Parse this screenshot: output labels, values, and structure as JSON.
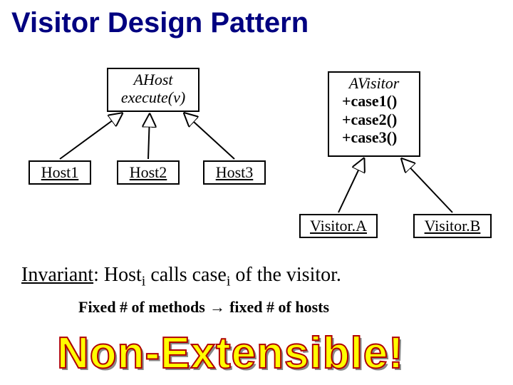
{
  "title": "Visitor Design Pattern",
  "abstract_host": {
    "name": "AHost",
    "method": "execute(v)"
  },
  "hosts": [
    "Host1",
    "Host2",
    "Host3"
  ],
  "abstract_visitor": {
    "name": "AVisitor",
    "methods": [
      "+case1()",
      "+case2()",
      "+case3()"
    ]
  },
  "visitors": [
    "Visitor.A",
    "Visitor.B"
  ],
  "invariant": {
    "label": "Invariant",
    "text_1": ": Host",
    "sub_1": "i",
    "text_2": " calls case",
    "sub_2": "i",
    "text_3": " of the visitor."
  },
  "fixed_line": {
    "left": "Fixed # of methods",
    "arrow": " → ",
    "right": "fixed # of hosts"
  },
  "wordart": "Non-Extensible!"
}
